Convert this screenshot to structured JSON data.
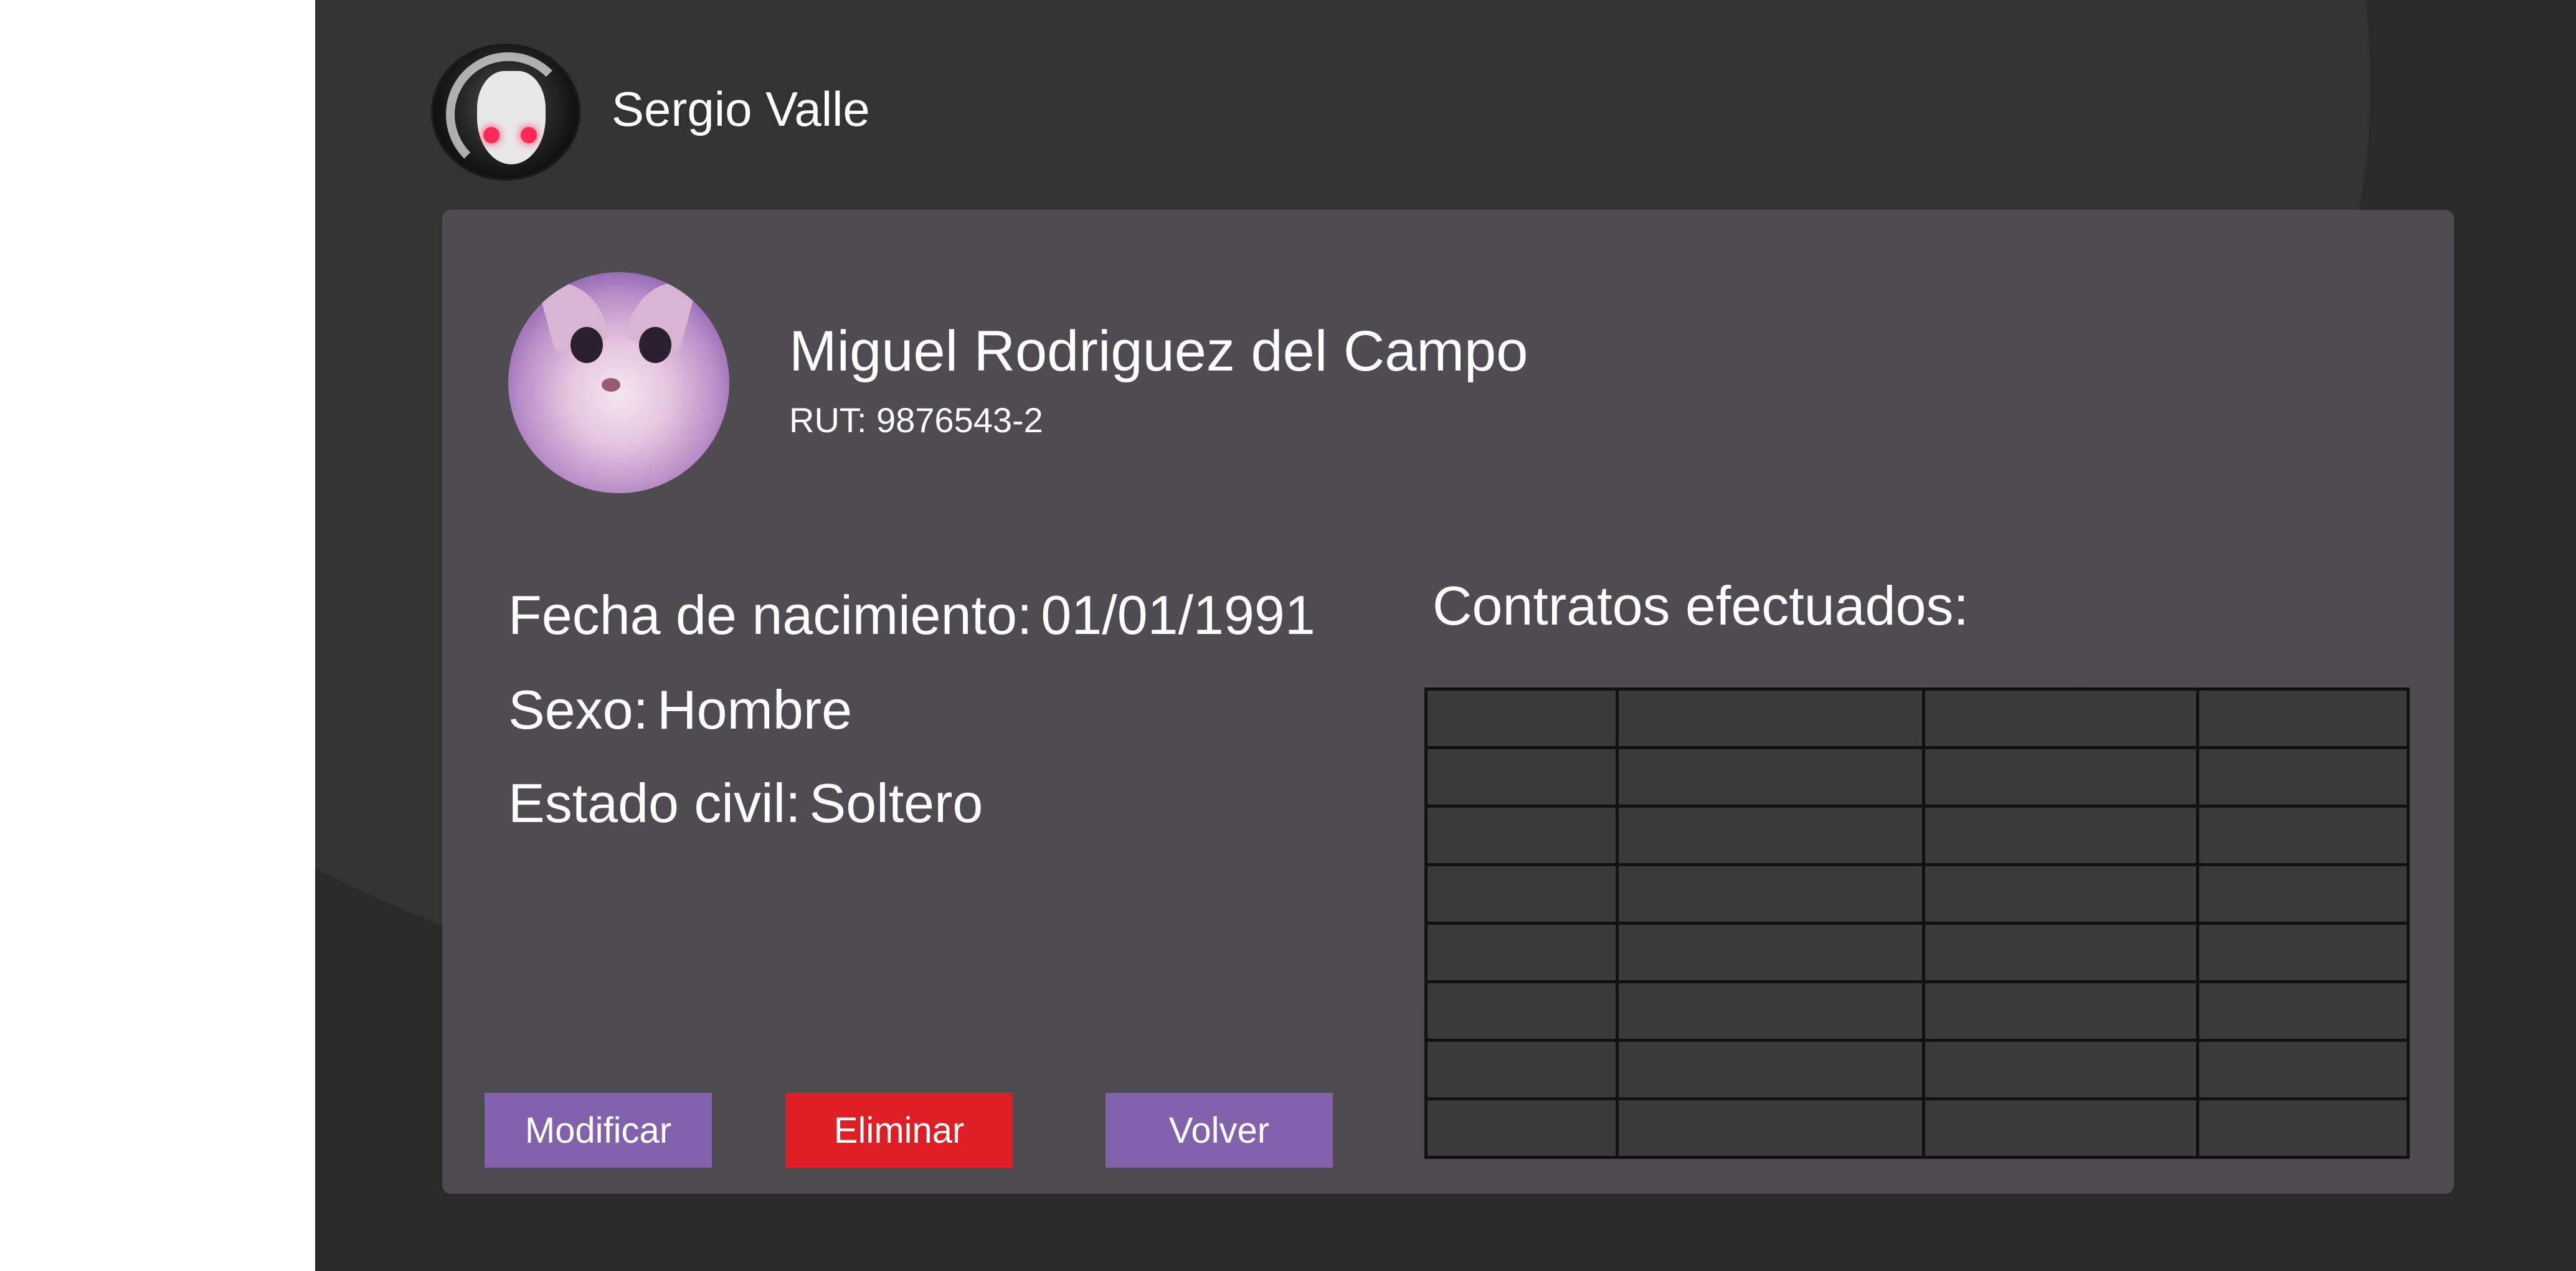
{
  "topbar": {
    "user_name": "Sergio Valle"
  },
  "profile": {
    "name": "Miguel Rodriguez del Campo",
    "rut": "RUT: 9876543-2"
  },
  "details": [
    {
      "label": "Fecha de nacimiento:",
      "value": "01/01/1991"
    },
    {
      "label": "Sexo:",
      "value": "Hombre"
    },
    {
      "label": "Estado civil:",
      "value": "Soltero"
    }
  ],
  "contracts": {
    "title": "Contratos efectuados:",
    "columns": 4,
    "rows": [
      [
        "",
        "",
        "",
        ""
      ],
      [
        "",
        "",
        "",
        ""
      ],
      [
        "",
        "",
        "",
        ""
      ],
      [
        "",
        "",
        "",
        ""
      ],
      [
        "",
        "",
        "",
        ""
      ],
      [
        "",
        "",
        "",
        ""
      ],
      [
        "",
        "",
        "",
        ""
      ],
      [
        "",
        "",
        "",
        ""
      ]
    ]
  },
  "actions": {
    "modify_label": "Modificar",
    "delete_label": "Eliminar",
    "back_label": "Volver"
  },
  "colors": {
    "background": "#2a2a2b",
    "card": "#504e54",
    "accent_purple": "#8262aa",
    "danger_red": "#e01e25"
  }
}
